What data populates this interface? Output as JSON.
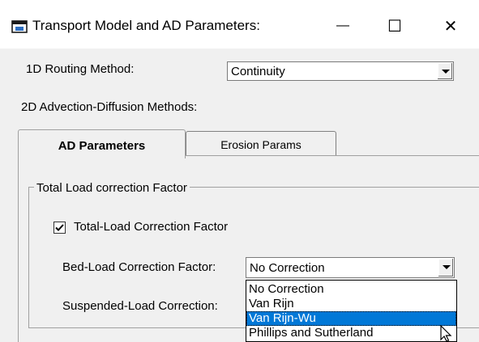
{
  "window": {
    "title": "Transport Model and AD Parameters:",
    "minimize_glyph": "—",
    "maximize_glyph": "☐",
    "close_glyph": "✕"
  },
  "routing": {
    "label": "1D Routing Method:",
    "value": "Continuity"
  },
  "advection": {
    "label": "2D Advection-Diffusion Methods:"
  },
  "tabs": [
    {
      "label": "AD Parameters",
      "active": true
    },
    {
      "label": "Erosion Params",
      "active": false
    }
  ],
  "group": {
    "title": "Total Load correction Factor",
    "checkbox_label": "Total-Load Correction Factor",
    "checkbox_checked": true,
    "bed_load_label": "Bed-Load Correction Factor:",
    "bed_load_value": "No Correction",
    "suspended_label": "Suspended-Load Correction:"
  },
  "dropdown": {
    "options": [
      "No Correction",
      "Van Rijn",
      "Van Rijn-Wu",
      "Phillips and Sutherland"
    ],
    "highlighted_index": 2
  },
  "colors": {
    "selection": "#0078d7",
    "window_bg": "#f0f0f0",
    "titlebar": "#ffffff"
  }
}
